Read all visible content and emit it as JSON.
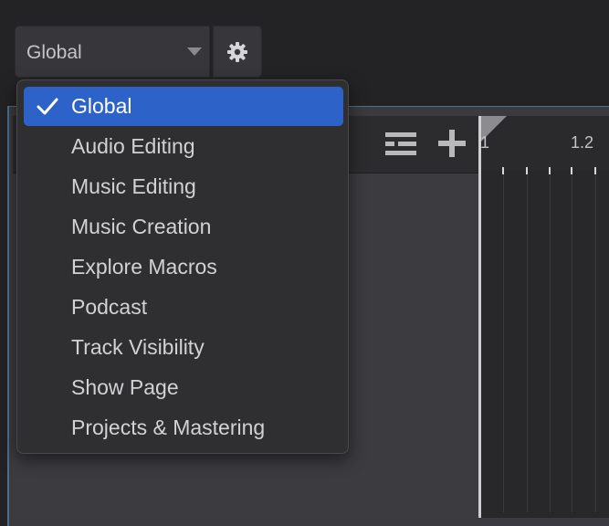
{
  "toolbar": {
    "preset_select": {
      "value": "Global"
    }
  },
  "menu": {
    "items": [
      {
        "label": "Global",
        "selected": true
      },
      {
        "label": "Audio Editing",
        "selected": false
      },
      {
        "label": "Music Editing",
        "selected": false
      },
      {
        "label": "Music Creation",
        "selected": false
      },
      {
        "label": "Explore Macros",
        "selected": false
      },
      {
        "label": "Podcast",
        "selected": false
      },
      {
        "label": "Track Visibility",
        "selected": false
      },
      {
        "label": "Show Page",
        "selected": false
      },
      {
        "label": "Projects & Mastering",
        "selected": false
      }
    ]
  },
  "ruler": {
    "labels": [
      "1",
      "1.2"
    ]
  },
  "icons": {
    "gear": "gear-icon",
    "caret": "chevron-down-icon",
    "list": "list-icon",
    "plus": "plus-icon",
    "check": "checkmark-icon"
  },
  "colors": {
    "selection": "#2d63c8",
    "panel_border": "#4c6f90"
  }
}
